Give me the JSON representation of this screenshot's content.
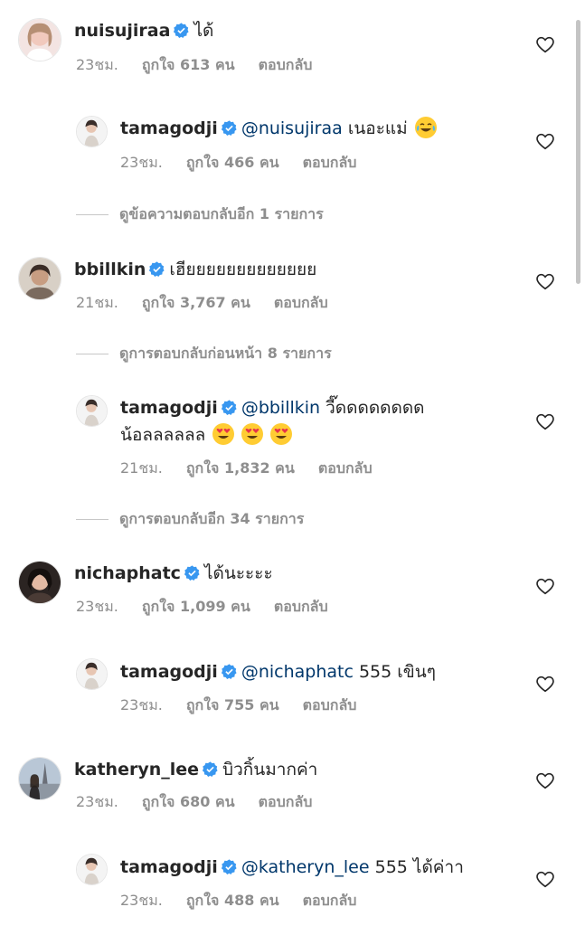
{
  "comments": [
    {
      "user": "nuisujiraa",
      "text": "ได้",
      "time": "23ชม.",
      "likes": "ถูกใจ 613 คน",
      "reply": "ตอบกลับ"
    },
    {
      "user": "tamagodji",
      "mention": "@nuisujiraa",
      "text": "เนอะแม่",
      "emoji": "face-with-tears-of-joy",
      "time": "23ชม.",
      "likes": "ถูกใจ 466 คน",
      "reply": "ตอบกลับ"
    },
    {
      "view_more": "ดูข้อความตอบกลับอีก 1 รายการ"
    },
    {
      "user": "bbillkin",
      "text": "เฮียยยยยยยยยยยยย",
      "time": "21ชม.",
      "likes": "ถูกใจ 3,767 คน",
      "reply": "ตอบกลับ"
    },
    {
      "view_prev": "ดูการตอบกลับก่อนหน้า 8 รายการ"
    },
    {
      "user": "tamagodji",
      "mention": "@bbillkin",
      "text": "วี๊ดดดดดดดด",
      "text2": "น้อลลลลลล",
      "emoji": "smiling-face-with-heart-eyes x3",
      "time": "21ชม.",
      "likes": "ถูกใจ 1,832 คน",
      "reply": "ตอบกลับ"
    },
    {
      "view_more": "ดูการตอบกลับอีก 34 รายการ"
    },
    {
      "user": "nichaphatc",
      "text": "ได้นะะะะ",
      "time": "23ชม.",
      "likes": "ถูกใจ 1,099 คน",
      "reply": "ตอบกลับ"
    },
    {
      "user": "tamagodji",
      "mention": "@nichaphatc",
      "text": "555 เขินๆ",
      "time": "23ชม.",
      "likes": "ถูกใจ 755 คน",
      "reply": "ตอบกลับ"
    },
    {
      "user": "katheryn_lee",
      "text": "บิวกิ้นมากค่า",
      "time": "23ชม.",
      "likes": "ถูกใจ 680 คน",
      "reply": "ตอบกลับ"
    },
    {
      "user": "tamagodji",
      "mention": "@katheryn_lee",
      "text": "555 ได้ค่าา",
      "time": "23ชม.",
      "likes": "ถูกใจ 488 คน",
      "reply": "ตอบกลับ"
    }
  ],
  "colors": {
    "text": "#262626",
    "meta": "#8e8e8e",
    "mention": "#00376b",
    "verified": "#3897f0"
  },
  "icons": {
    "like": "heart-outline-icon",
    "verified": "verified-badge-icon"
  }
}
